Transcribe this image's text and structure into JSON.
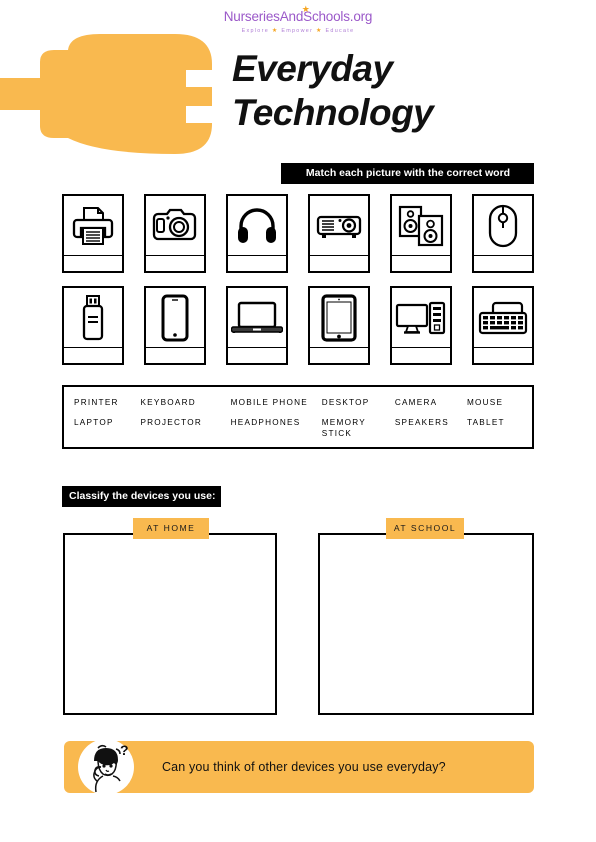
{
  "logo": {
    "name": "NurseriesAndSchools.org",
    "tagline_parts": [
      "Explore",
      "Empower",
      "Educate"
    ],
    "tagline": "Explore ★ Empower ★ Educate",
    "color": "#9b59c9",
    "star_color": "#f5a623"
  },
  "title": {
    "line1": "Everyday",
    "line2": "Technology"
  },
  "colors": {
    "accent_orange": "#f9b94f",
    "banner_black": "#000000",
    "ink": "#111111"
  },
  "sections": {
    "match_banner": "Match each picture with the correct word",
    "classify_banner": "Classify the devices you use:"
  },
  "cards": {
    "row1": [
      {
        "icon": "printer-icon",
        "answer": ""
      },
      {
        "icon": "camera-icon",
        "answer": ""
      },
      {
        "icon": "headphones-icon",
        "answer": ""
      },
      {
        "icon": "projector-icon",
        "answer": ""
      },
      {
        "icon": "speakers-icon",
        "answer": ""
      },
      {
        "icon": "mouse-icon",
        "answer": ""
      }
    ],
    "row2": [
      {
        "icon": "memory-stick-icon",
        "answer": ""
      },
      {
        "icon": "mobile-phone-icon",
        "answer": ""
      },
      {
        "icon": "laptop-icon",
        "answer": ""
      },
      {
        "icon": "tablet-icon",
        "answer": ""
      },
      {
        "icon": "desktop-icon",
        "answer": ""
      },
      {
        "icon": "keyboard-icon",
        "answer": ""
      }
    ]
  },
  "word_bank": {
    "row1": [
      "PRINTER",
      "KEYBOARD",
      "MOBILE PHONE",
      "DESKTOP",
      "CAMERA",
      "MOUSE"
    ],
    "row2": [
      "LAPTOP",
      "PROJECTOR",
      "HEADPHONES",
      "MEMORY STICK",
      "SPEAKERS",
      "TABLET"
    ]
  },
  "classify": {
    "home_label": "AT HOME",
    "school_label": "AT SCHOOL",
    "home_content": "",
    "school_content": ""
  },
  "footer": {
    "prompt": "Can you think of other devices you use everyday?",
    "figure": "thinking-person-icon"
  }
}
